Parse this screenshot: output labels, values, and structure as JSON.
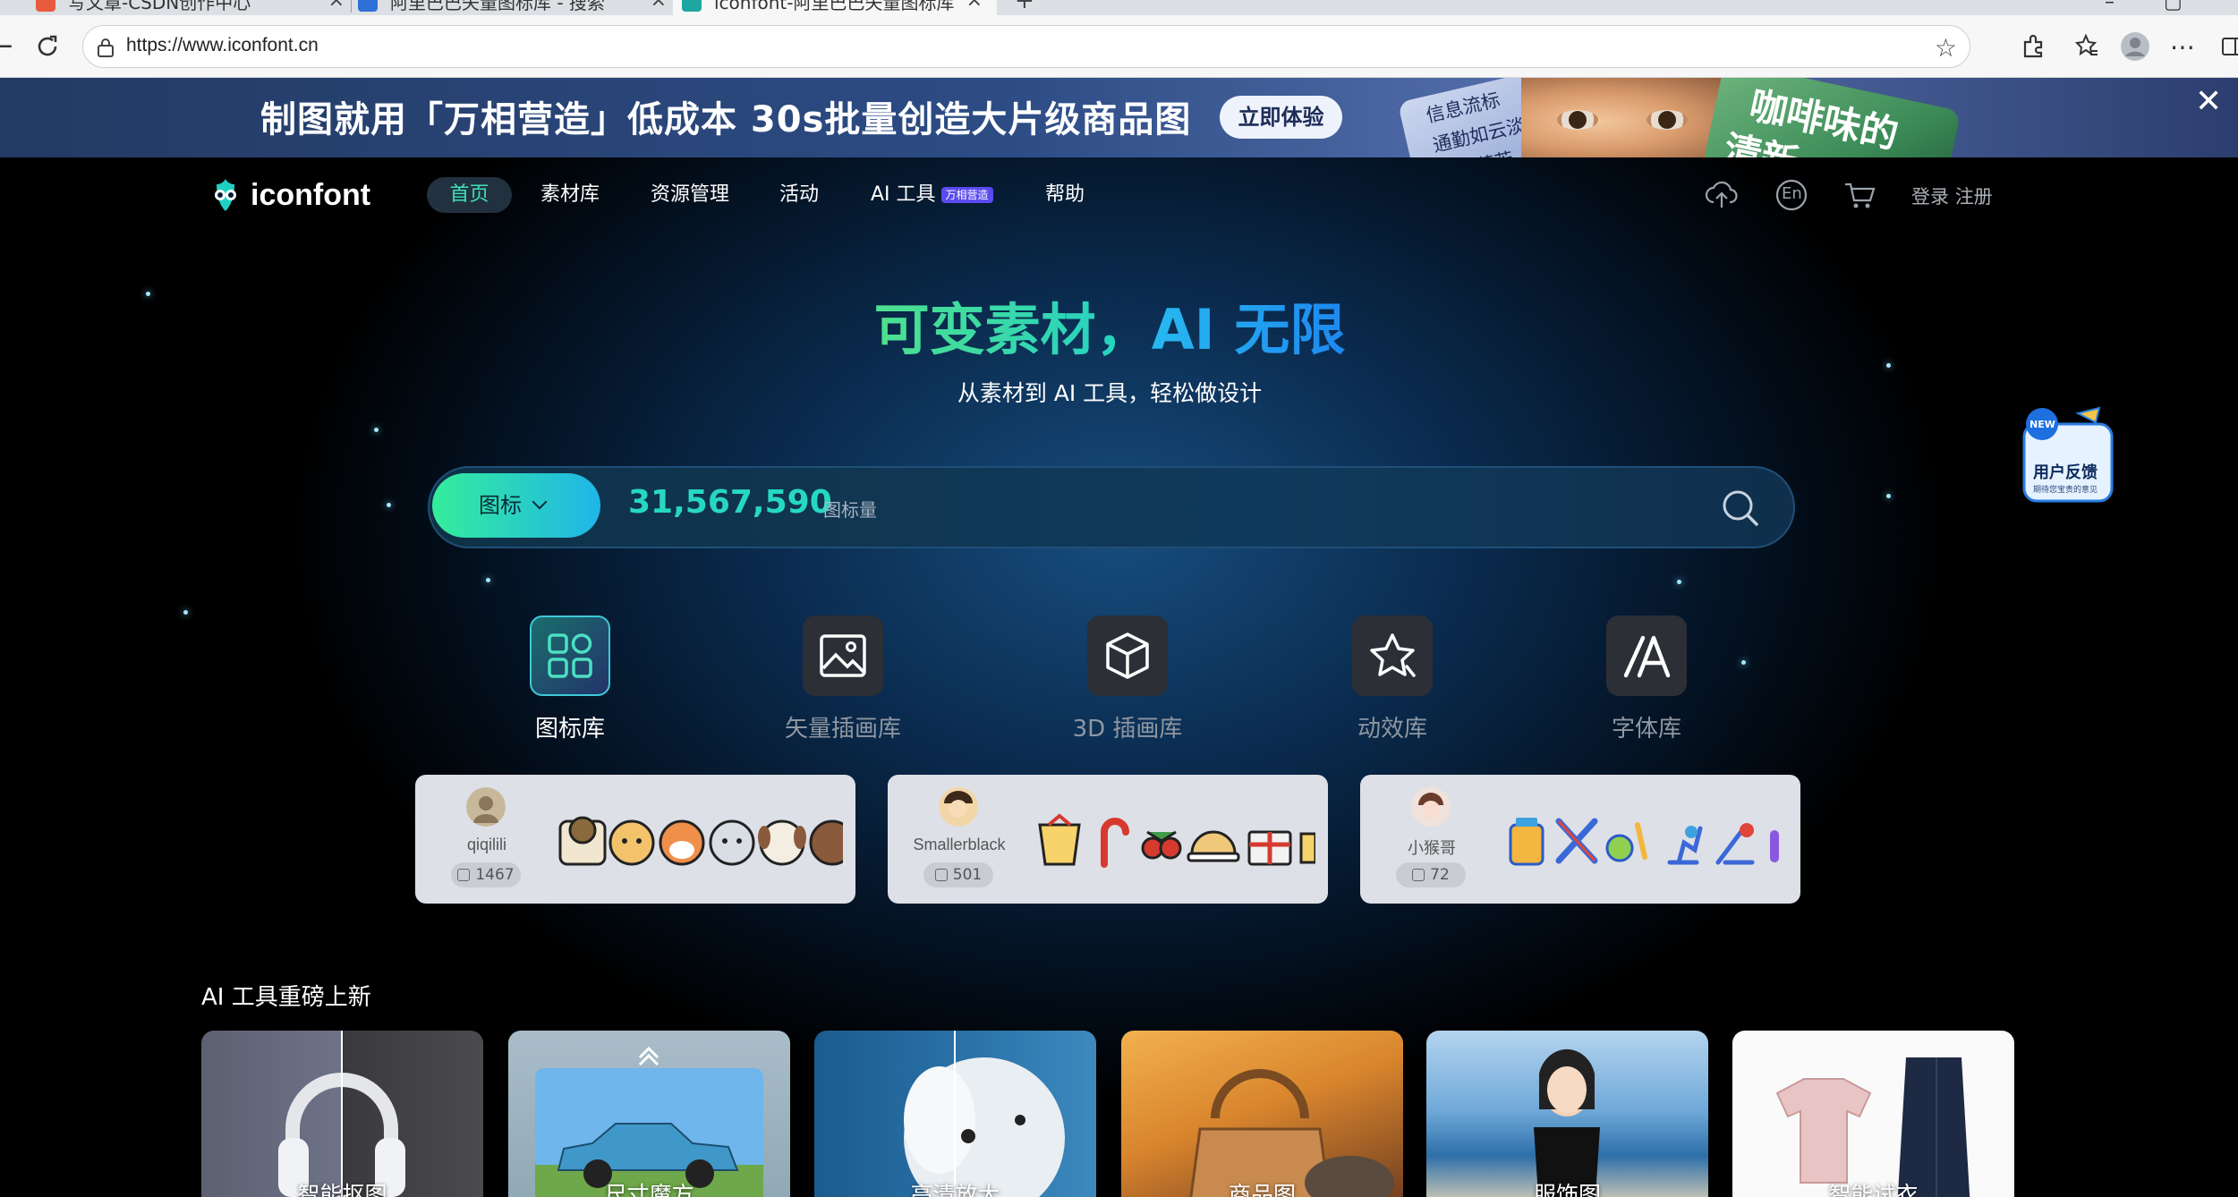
{
  "browser": {
    "tabs": [
      {
        "title": "写文章-CSDN创作中心"
      },
      {
        "title": "阿里巴巴矢量图标库 - 搜索"
      },
      {
        "title": "iconfont-阿里巴巴矢量图标库"
      }
    ],
    "url": "https://www.iconfont.cn"
  },
  "ad": {
    "headline": "制图就用「万相营造」低成本 30s批量创造大片级商品图",
    "cta": "立即体验",
    "card1": [
      "信息流标",
      "通勤如云淡",
      "奶糖芬芳"
    ],
    "card2": [
      "咖啡味的",
      "清新"
    ]
  },
  "header": {
    "logo": "iconfont",
    "nav": [
      {
        "label": "首页"
      },
      {
        "label": "素材库"
      },
      {
        "label": "资源管理"
      },
      {
        "label": "活动"
      },
      {
        "label": "AI 工具",
        "badge": "万相营造"
      },
      {
        "label": "帮助"
      }
    ],
    "lang": "En",
    "login": "登录",
    "register": "注册"
  },
  "hero": {
    "title_part1": "可变素材，",
    "title_part2": "AI 无限",
    "subtitle": "从素材到 AI 工具，轻松做设计"
  },
  "search": {
    "type": "图标",
    "count": "31,567,590",
    "count_unit": "图标量"
  },
  "libraries": [
    {
      "label": "图标库",
      "icon": "grid-icon",
      "active": true
    },
    {
      "label": "矢量插画库",
      "icon": "image-icon",
      "active": false
    },
    {
      "label": "3D 插画库",
      "icon": "cube-icon",
      "active": false
    },
    {
      "label": "动效库",
      "icon": "star-motion-icon",
      "active": false
    },
    {
      "label": "字体库",
      "icon": "font-icon",
      "active": false
    }
  ],
  "creators": [
    {
      "name": "qiqilili",
      "likes": "1467"
    },
    {
      "name": "Smallerblack",
      "likes": "501"
    },
    {
      "name": "小猴哥",
      "likes": "72"
    }
  ],
  "ai_section": {
    "title": "AI 工具重磅上新",
    "tools": [
      {
        "label": "智能抠图"
      },
      {
        "label": "尺寸魔方"
      },
      {
        "label": "高清放大"
      },
      {
        "label": "商品图"
      },
      {
        "label": "服饰图"
      },
      {
        "label": "智能试衣"
      }
    ]
  },
  "feedback": {
    "badge": "NEW",
    "title": "用户反馈",
    "subtitle": "期待您宝贵的意见"
  },
  "colors": {
    "accent_green": "#35ed9b",
    "accent_blue": "#1fb5e8",
    "count_color": "#27d8c0"
  }
}
